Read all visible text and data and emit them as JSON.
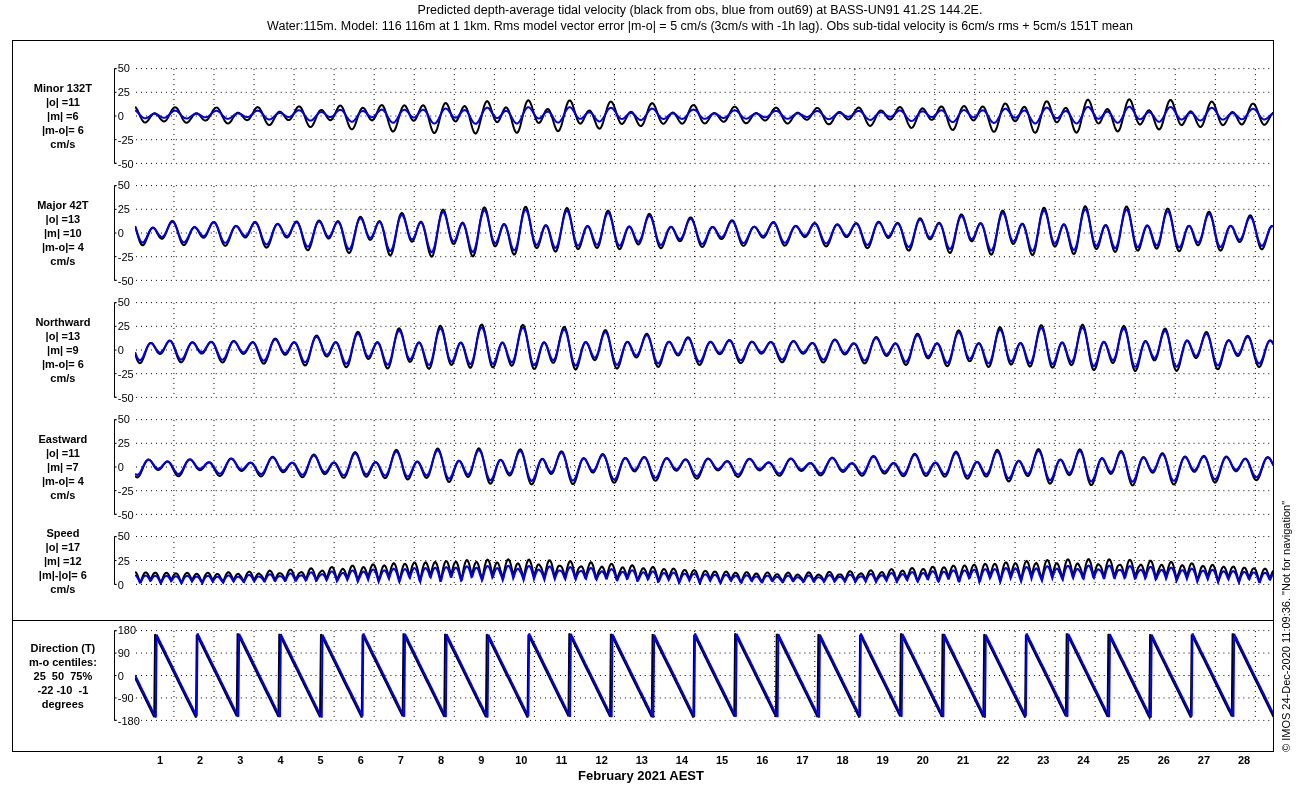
{
  "title": [
    "Predicted depth-average tidal velocity (black from obs, blue from out69) at BASS-UN91 41.2S 144.2E.",
    "Water:115m. Model: 116 116m at 1 1km. Rms model vector error |m-o| = 5 cm/s (3cm/s with -1h lag). Obs sub-tidal velocity is 6cm/s rms + 5cm/s 151T mean"
  ],
  "panels": [
    {
      "kind": "velocity",
      "label": "Minor 132T",
      "stats": [
        "|o| =11",
        "|m| =6",
        "|m-o|= 6",
        "cm/s"
      ],
      "yticks": [
        "50",
        "25",
        "0",
        "-25",
        "-50"
      ]
    },
    {
      "kind": "velocity",
      "label": "Major 42T",
      "stats": [
        "|o| =13",
        "|m| =10",
        "|m-o|= 4",
        "cm/s"
      ],
      "yticks": [
        "50",
        "25",
        "0",
        "-25",
        "-50"
      ]
    },
    {
      "kind": "velocity",
      "label": "Northward",
      "stats": [
        "|o| =13",
        "|m| =9",
        "|m-o|= 6",
        "cm/s"
      ],
      "yticks": [
        "50",
        "25",
        "0",
        "-25",
        "-50"
      ]
    },
    {
      "kind": "velocity",
      "label": "Eastward",
      "stats": [
        "|o| =11",
        "|m| =7",
        "|m-o|= 4",
        "cm/s"
      ],
      "yticks": [
        "50",
        "25",
        "0",
        "-25",
        "-50"
      ]
    },
    {
      "kind": "speed",
      "label": "Speed",
      "stats": [
        "|o| =17",
        "|m| =12",
        "|m|-|o|= 6",
        "cm/s"
      ],
      "yticks": [
        "50",
        "25",
        "0"
      ]
    },
    {
      "kind": "direction",
      "label": "Direction (T)",
      "stats": [
        "m-o centiles:",
        "25  50  75%",
        "-22 -10  -1",
        "degrees"
      ],
      "yticks": [
        "180",
        "90",
        "0",
        "-90",
        "-180"
      ]
    }
  ],
  "xticks": [
    "1",
    "2",
    "3",
    "4",
    "5",
    "6",
    "7",
    "8",
    "9",
    "10",
    "11",
    "12",
    "13",
    "14",
    "15",
    "16",
    "17",
    "18",
    "19",
    "20",
    "21",
    "22",
    "23",
    "24",
    "25",
    "26",
    "27",
    "28"
  ],
  "xlabel": "February 2021 AEST",
  "credit": "© IMOS 24-Dec-2020 11:09:36. \"Not for navigation\""
}
